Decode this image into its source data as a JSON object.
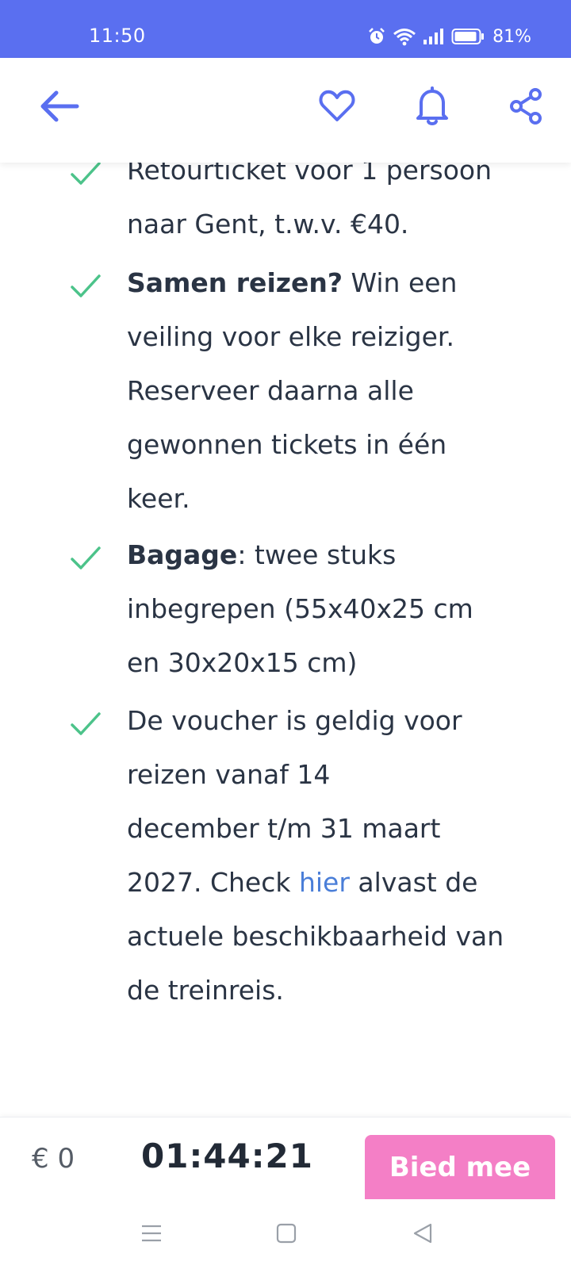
{
  "status_bar": {
    "time": "11:50",
    "battery_percent": "81%",
    "icons": [
      "alarm-icon",
      "wifi-icon",
      "signal-icon",
      "battery-icon"
    ]
  },
  "app_bar": {
    "icons": [
      "arrow-left-icon",
      "heart-icon",
      "bell-icon",
      "share-icon"
    ],
    "accent_color": "#5a6ff0"
  },
  "features": [
    {
      "lines": [
        {
          "text": "Retourticket voor 1 persoon"
        },
        {
          "text": "naar Gent, t.w.v. €40."
        }
      ]
    },
    {
      "lines": [
        {
          "bold": "Samen reizen?",
          "text": " Win een"
        },
        {
          "text": "veiling voor elke reiziger."
        },
        {
          "text": "Reserveer daarna alle"
        },
        {
          "text": "gewonnen tickets in één"
        },
        {
          "text": "keer."
        }
      ]
    },
    {
      "lines": [
        {
          "bold": "Bagage",
          "text": ": twee stuks"
        },
        {
          "text": "inbegrepen (55x40x25 cm"
        },
        {
          "text": "en 30x20x15 cm)"
        }
      ]
    },
    {
      "lines": [
        {
          "text": "De voucher is geldig voor"
        },
        {
          "text": "reizen vanaf 14"
        },
        {
          "text": "december t/m 31 maart"
        },
        {
          "text": "2027. Check ",
          "link": "hier",
          "after": " alvast de"
        },
        {
          "text": "actuele beschikbaarheid van"
        },
        {
          "text": "de treinreis."
        }
      ]
    }
  ],
  "check_color": "#4cc38a",
  "link_color": "#4a7ed8",
  "bottom_bar": {
    "price": "€ 0",
    "countdown": "01:44:21",
    "bid_button_label": "Bied mee",
    "bid_button_color": "#f47fc6"
  },
  "nav_bar": {
    "icons": [
      "menu-icon",
      "home-square-icon",
      "back-triangle-icon"
    ]
  }
}
